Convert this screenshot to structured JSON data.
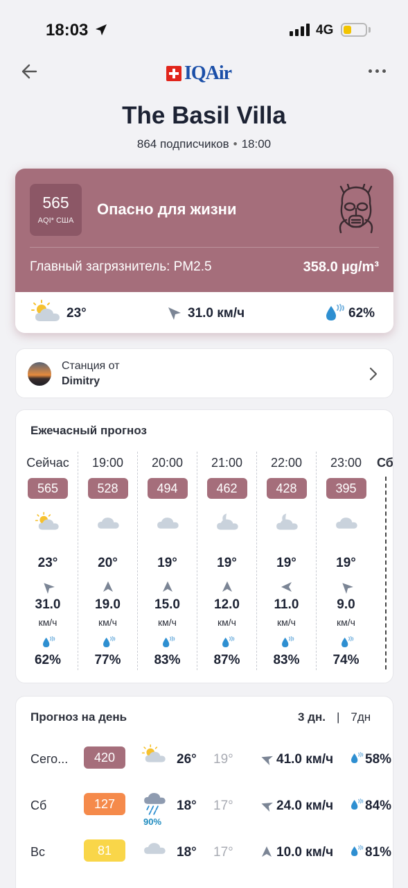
{
  "status_bar": {
    "time": "18:03",
    "network": "4G",
    "battery_level": 0.3
  },
  "header": {
    "brand": "IQAir",
    "title": "The Basil Villa",
    "followers": "864 подписчиков",
    "updated": "18:00"
  },
  "aqi": {
    "value": "565",
    "label": "AQI* США",
    "status": "Опасно для жизни",
    "pollutant_label": "Главный загрязнитель: ",
    "pollutant": "PM2.5",
    "concentration": "358.0 µg/m³",
    "color": "#a56e7b",
    "weather": {
      "temp": "23°",
      "wind": "31.0 км/ч",
      "humidity": "62%"
    }
  },
  "station": {
    "label": "Станция от",
    "name": "Dimitry"
  },
  "hourly": {
    "title": "Ежечасный прогноз",
    "next_day_label": "Сб",
    "hours": [
      {
        "time": "Сейчас",
        "aqi": "565",
        "icon": "partly-cloudy-icon",
        "temp": "23°",
        "wind": "31.0",
        "wind_unit": "км/ч",
        "humidity": "62%",
        "wind_dir_deg": 315
      },
      {
        "time": "19:00",
        "aqi": "528",
        "icon": "cloud-icon",
        "temp": "20°",
        "wind": "19.0",
        "wind_unit": "км/ч",
        "humidity": "77%",
        "wind_dir_deg": 0
      },
      {
        "time": "20:00",
        "aqi": "494",
        "icon": "cloud-icon",
        "temp": "19°",
        "wind": "15.0",
        "wind_unit": "км/ч",
        "humidity": "83%",
        "wind_dir_deg": 0
      },
      {
        "time": "21:00",
        "aqi": "462",
        "icon": "night-cloud-icon",
        "temp": "19°",
        "wind": "12.0",
        "wind_unit": "км/ч",
        "humidity": "87%",
        "wind_dir_deg": 0
      },
      {
        "time": "22:00",
        "aqi": "428",
        "icon": "night-cloud-icon",
        "temp": "19°",
        "wind": "11.0",
        "wind_unit": "км/ч",
        "humidity": "83%",
        "wind_dir_deg": 270
      },
      {
        "time": "23:00",
        "aqi": "395",
        "icon": "cloud-icon",
        "temp": "19°",
        "wind": "9.0",
        "wind_unit": "км/ч",
        "humidity": "74%",
        "wind_dir_deg": 315
      }
    ]
  },
  "daily": {
    "title": "Прогноз на день",
    "toggle_active": "3 дн.",
    "toggle_sep": "|",
    "toggle_inactive": "7дн",
    "days": [
      {
        "day": "Сего...",
        "aqi": "420",
        "aqi_color": "#a56e7b",
        "icon": "partly-cloudy-icon",
        "precip": "",
        "hi": "26°",
        "lo": "19°",
        "wind": "41.0 км/ч",
        "humidity": "58%"
      },
      {
        "day": "Сб",
        "aqi": "127",
        "aqi_color": "#f58a4b",
        "icon": "rain-cloud-icon",
        "precip": "90%",
        "hi": "18°",
        "lo": "17°",
        "wind": "24.0 км/ч",
        "humidity": "84%"
      },
      {
        "day": "Вс",
        "aqi": "81",
        "aqi_color": "#f9d649",
        "icon": "cloud-icon",
        "precip": "",
        "hi": "18°",
        "lo": "17°",
        "wind": "10.0 км/ч",
        "humidity": "81%"
      }
    ]
  }
}
